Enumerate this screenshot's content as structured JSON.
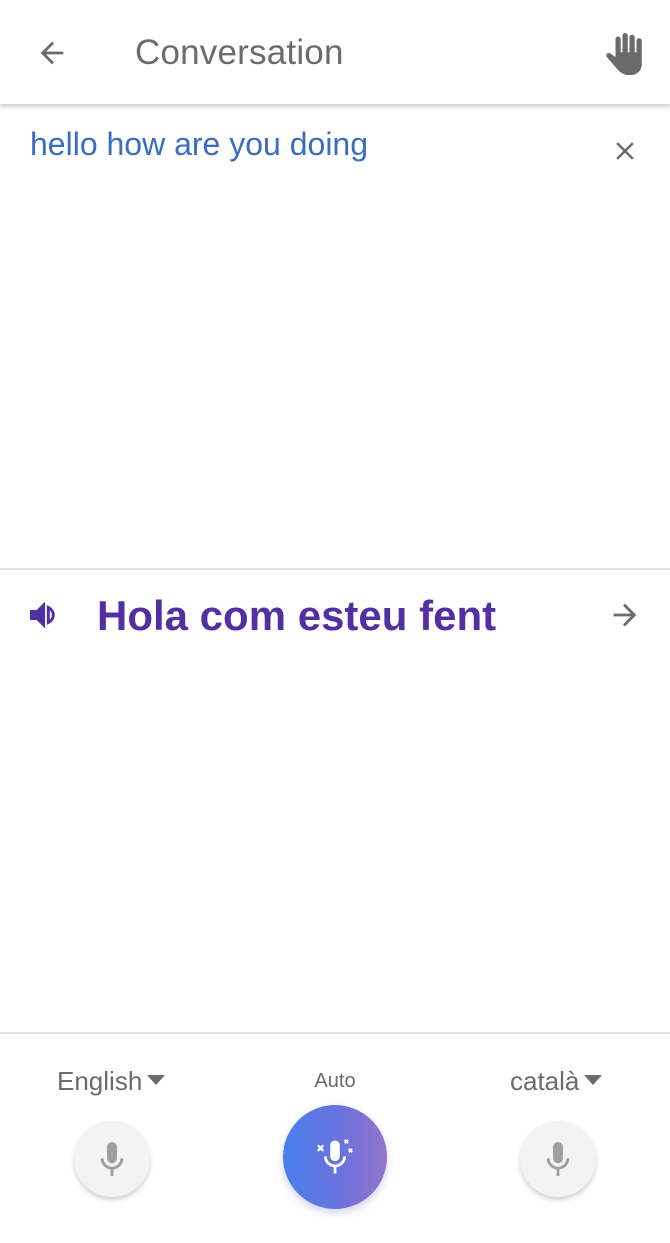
{
  "header": {
    "title": "Conversation",
    "back_icon": "arrow-left-icon",
    "hand_icon": "hand-icon"
  },
  "source": {
    "text": "hello how are you doing",
    "close_icon": "close-icon",
    "color": "#3a6cc2"
  },
  "target": {
    "text": "Hola com esteu fent",
    "speaker_icon": "volume-icon",
    "forward_icon": "arrow-right-icon",
    "color": "#5230a4"
  },
  "bottom": {
    "left_language": "English",
    "right_language": "català",
    "auto_label": "Auto",
    "left_mic_icon": "mic-icon",
    "auto_mic_icon": "auto-mic-sparkle-icon",
    "right_mic_icon": "mic-icon",
    "auto_gradient": [
      "#4a80ec",
      "#9473cd"
    ]
  }
}
